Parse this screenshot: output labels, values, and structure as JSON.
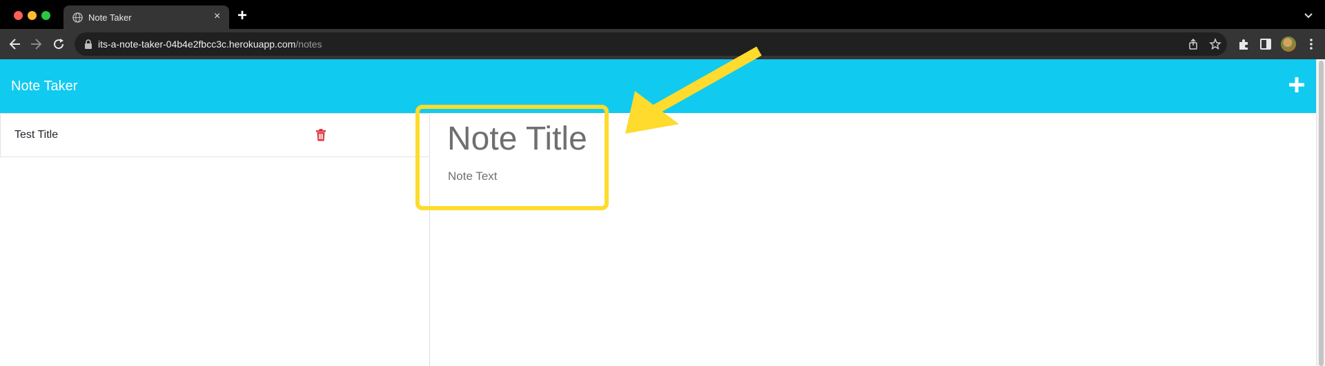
{
  "browser": {
    "tab_title": "Note Taker",
    "tab_close": "×",
    "new_tab": "+",
    "url_domain": "its-a-note-taker-04b4e2fbcc3c.herokuapp.com",
    "url_path": "/notes"
  },
  "app": {
    "title": "Note Taker",
    "colors": {
      "header": "#11caf0",
      "delete": "#dc3545",
      "annotation": "#fedb2c"
    }
  },
  "notes_list": [
    {
      "title": "Test Title"
    }
  ],
  "editor": {
    "title_placeholder": "Note Title",
    "text_placeholder": "Note Text"
  }
}
